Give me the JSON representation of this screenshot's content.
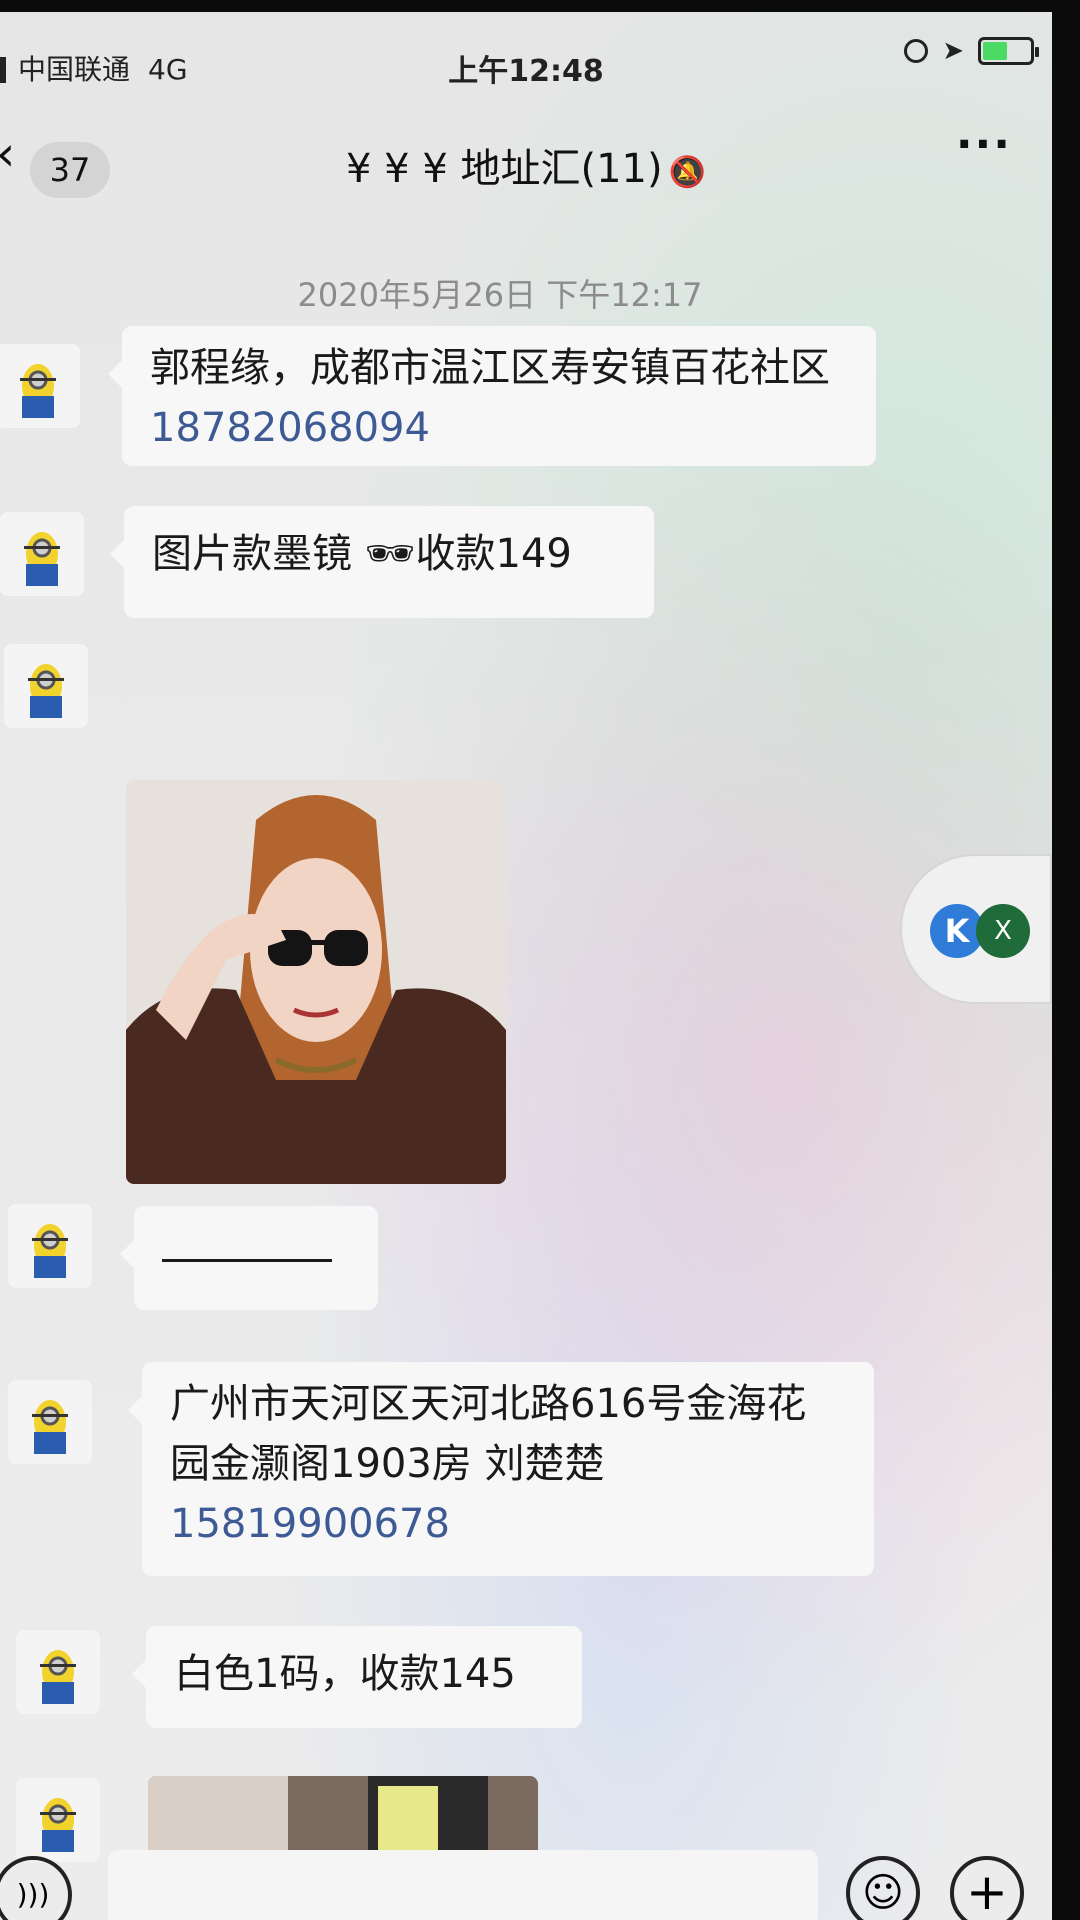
{
  "status_bar": {
    "carrier": "中国联通",
    "network": "4G",
    "time": "上午12:48"
  },
  "nav": {
    "back_icon": "chevron-left-icon",
    "unread_count": "37",
    "title": "¥ ¥ ¥ 地址汇(11)",
    "mute_icon": "bell-slash-icon",
    "more_icon": "more-dots-icon",
    "more_text": "···"
  },
  "timestamp": "2020年5月26日 下午12:17",
  "messages": [
    {
      "text": "郭程缘，成都市温江区寿安镇百花社区 ",
      "phone": "18782068094"
    },
    {
      "text": "图片款墨镜 🕶收款149"
    },
    {
      "type": "image",
      "description": ""
    },
    {
      "type": "divider"
    },
    {
      "text": "广州市天河区天河北路616号金海花园金灏阁1903房 刘楚楚 ",
      "phone": "15819900678"
    },
    {
      "text": "白色1码，收款145"
    }
  ],
  "float_widget": {
    "k_label": "K",
    "x_label": "X"
  },
  "input_bar": {
    "voice_icon": "voice-icon",
    "emoji_icon": "emoji-icon",
    "plus_icon": "plus-icon"
  },
  "colors": {
    "bubble": "#f7f7f7",
    "background": "#e8e8e8",
    "link": "#3d5a95"
  }
}
